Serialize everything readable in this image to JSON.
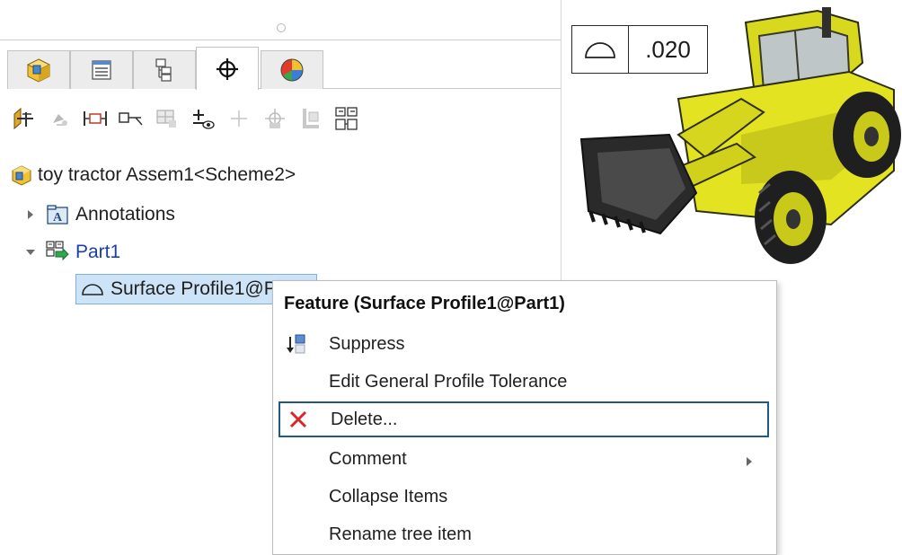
{
  "tabs": [
    {
      "name": "feature-manager"
    },
    {
      "name": "property-manager"
    },
    {
      "name": "configuration-manager"
    },
    {
      "name": "dimxpert-manager"
    },
    {
      "name": "display-manager"
    }
  ],
  "toolbar_icons": [
    "auto-dimension-scheme-icon",
    "datum-icon",
    "size-dimension-icon",
    "location-dimension-icon",
    "geometric-tolerance-icon",
    "show-tolerance-status-icon",
    "copy-scheme-icon",
    "tg-pattern-icon",
    "datum-target-icon",
    "import-scheme-icon"
  ],
  "tree": {
    "root_label": "toy tractor Assem1<Scheme2>",
    "annotations_label": "Annotations",
    "part_label": "Part1",
    "selected_label": "Surface Profile1@Part1"
  },
  "tolerance_frame": {
    "symbol": "surface-profile-icon",
    "value": ".020"
  },
  "context_menu": {
    "title": "Feature (Surface Profile1@Part1)",
    "items": [
      {
        "label": "Suppress",
        "icon": "suppress-icon"
      },
      {
        "label": "Edit General Profile Tolerance",
        "icon": ""
      },
      {
        "label": "Delete...",
        "icon": "delete-x-icon"
      },
      {
        "label": "Comment",
        "icon": "",
        "submenu": true
      },
      {
        "label": "Collapse Items",
        "icon": ""
      },
      {
        "label": "Rename tree item",
        "icon": ""
      }
    ]
  },
  "colors": {
    "selection_bg": "#cde3f7",
    "tree_blue": "#1b3fa8",
    "tractor_yellow": "#e6e61a",
    "delete_red": "#d9262b"
  }
}
